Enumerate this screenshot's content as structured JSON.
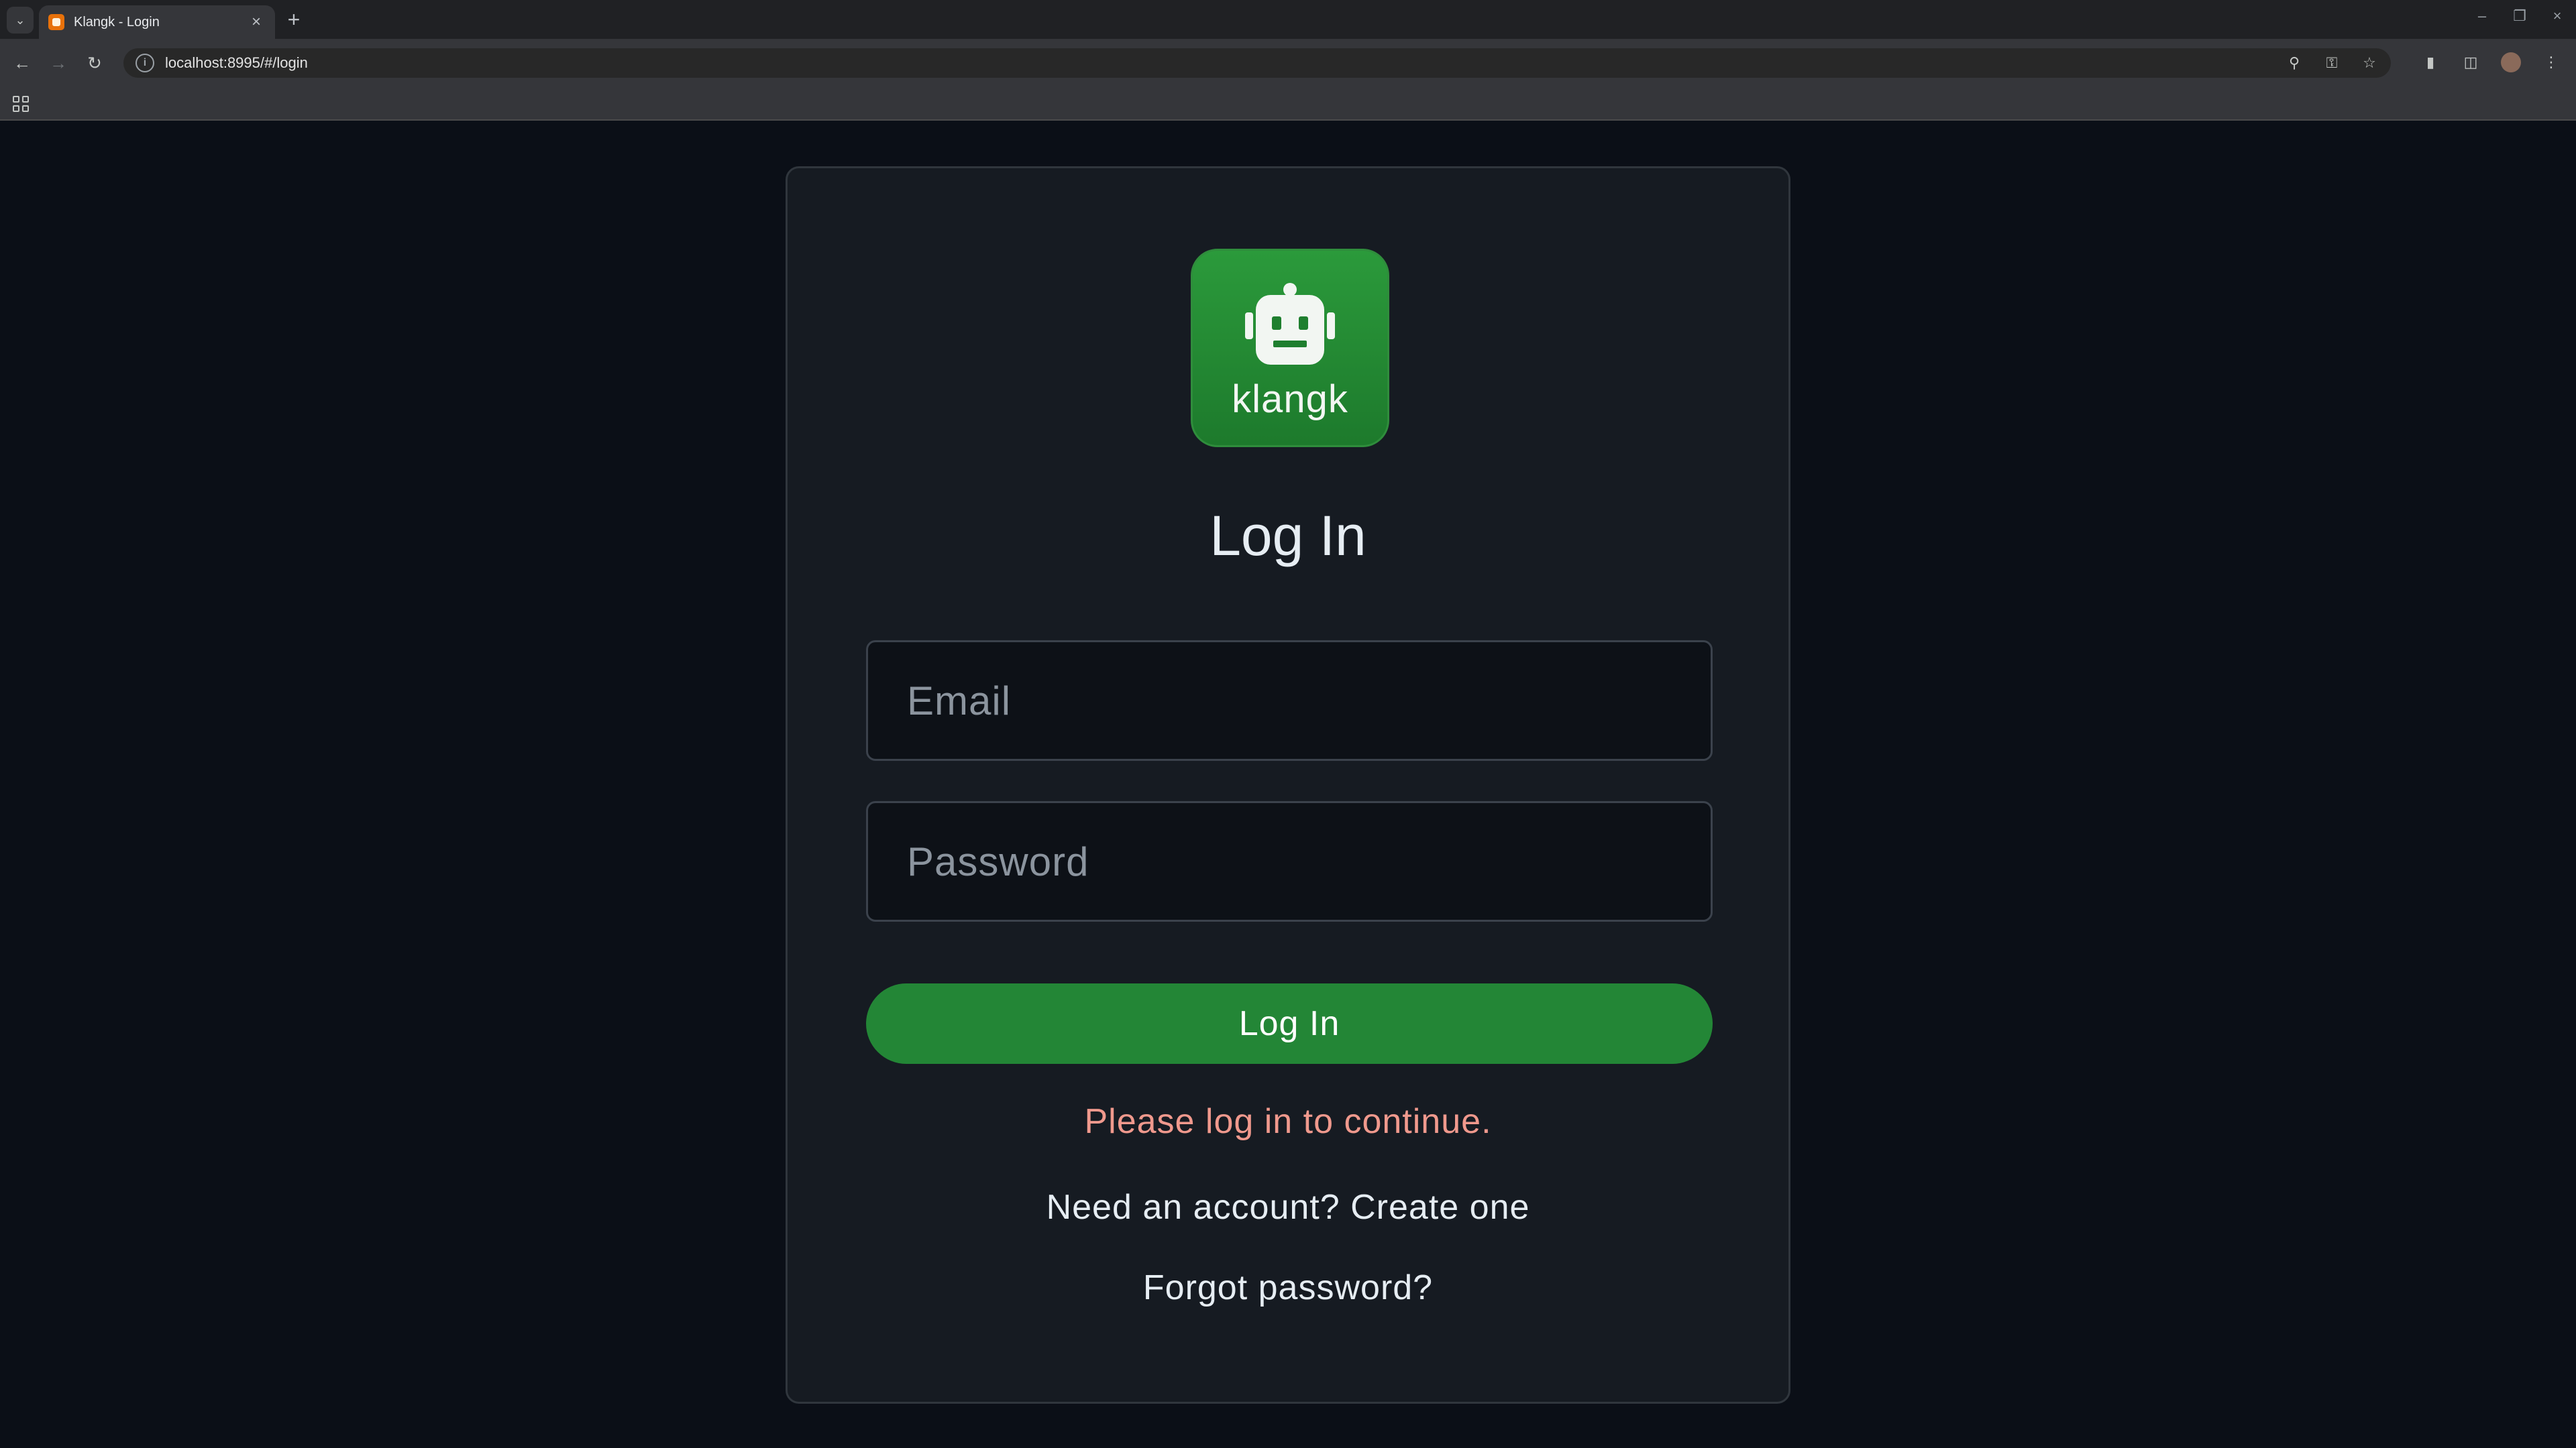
{
  "browser": {
    "tab_title": "Klangk - Login",
    "url": "localhost:8995/#/login"
  },
  "app": {
    "logo_text": "klangk",
    "heading": "Log In",
    "email_placeholder": "Email",
    "password_placeholder": "Password",
    "login_button": "Log In",
    "status_message": "Please log in to continue.",
    "signup_link": "Need an account? Create one",
    "forgot_link": "Forgot password?"
  },
  "colors": {
    "page_bg": "#0b0f17",
    "card_bg": "#161b22",
    "accent": "#238636",
    "status": "#f0998d"
  }
}
